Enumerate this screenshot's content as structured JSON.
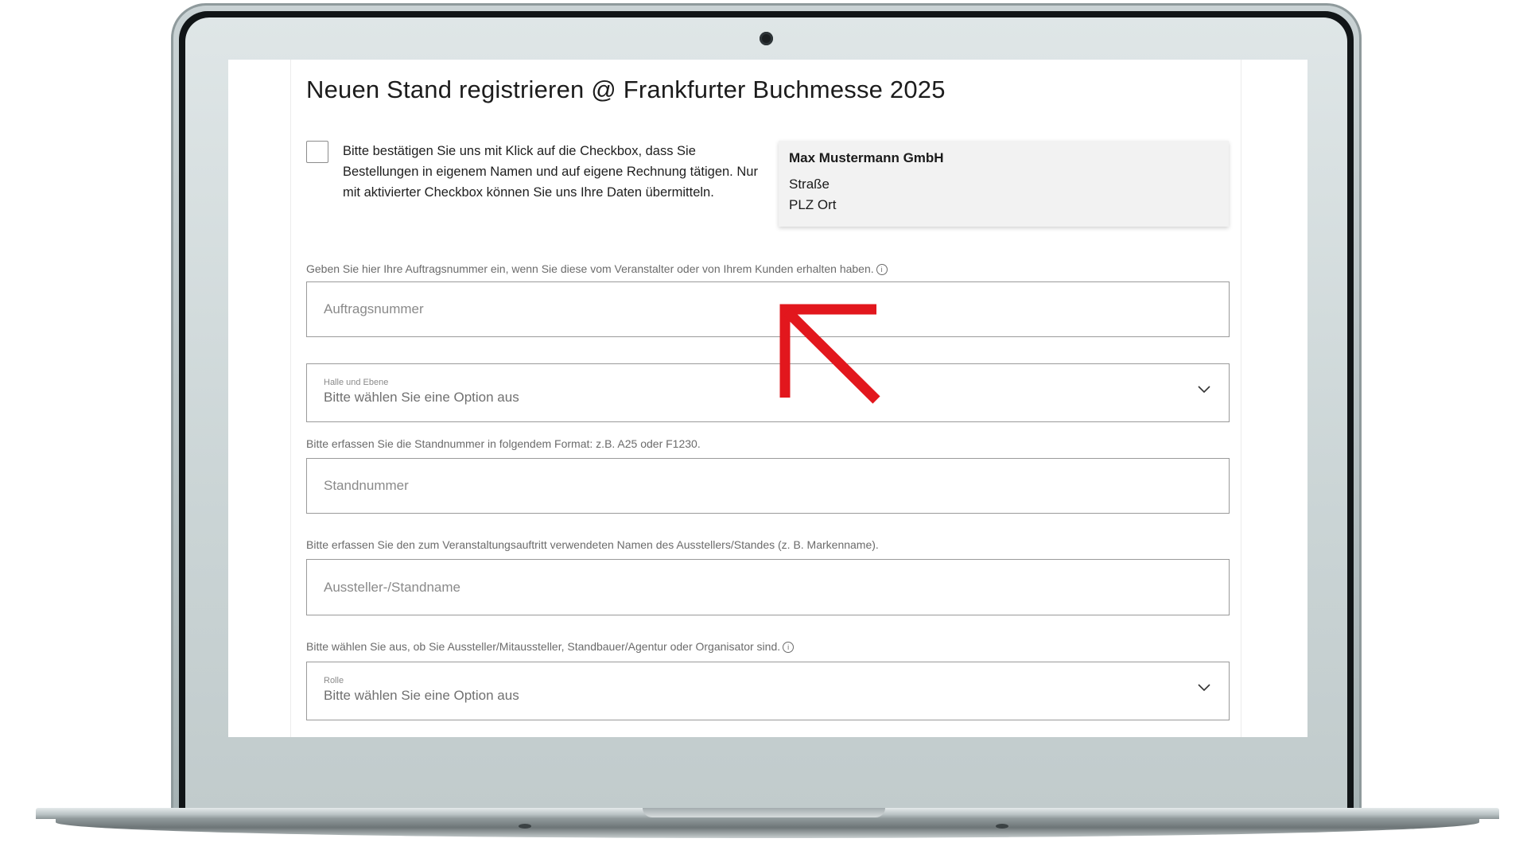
{
  "form": {
    "title": "Neuen Stand registrieren @  Frankfurter Buchmesse 2025",
    "consent_text": "Bitte bestätigen Sie uns mit Klick auf die Checkbox, dass Sie Bestellungen in eigenem Namen und auf eigene Rechnung tätigen. Nur mit aktivierter Checkbox können Sie uns Ihre Daten übermitteln.",
    "consent_checked": false,
    "address": {
      "company": "Max Mustermann GmbH",
      "street": "Straße",
      "city": "PLZ Ort"
    },
    "order_number": {
      "hint": "Geben Sie hier Ihre Auftragsnummer ein, wenn Sie diese vom Veranstalter oder von Ihrem Kunden erhalten haben.",
      "placeholder": "Auftragsnummer",
      "value": ""
    },
    "hall_level": {
      "label": "Halle und Ebene",
      "value": "Bitte wählen Sie eine Option aus"
    },
    "stand_number": {
      "hint": "Bitte erfassen Sie die Standnummer in folgendem Format: z.B. A25 oder F1230.",
      "placeholder": "Standnummer",
      "value": ""
    },
    "stand_name": {
      "hint": "Bitte erfassen Sie den zum Veranstaltungsauftritt verwendeten Namen des Ausstellers/Standes (z. B. Markenname).",
      "placeholder": "Aussteller-/Standname",
      "value": ""
    },
    "role": {
      "hint": "Bitte wählen Sie aus, ob Sie Aussteller/Mitaussteller, Standbauer/Agentur oder Organisator sind.",
      "label": "Rolle",
      "value": "Bitte wählen Sie eine Option aus"
    }
  },
  "icons": {
    "info": "info-icon",
    "dropdown": "chevron-down-icon",
    "annotation": "red-arrow"
  },
  "colors": {
    "annotation_arrow": "#e2171d",
    "field_border": "#9a9a9a",
    "address_background": "#f2f2f2"
  }
}
